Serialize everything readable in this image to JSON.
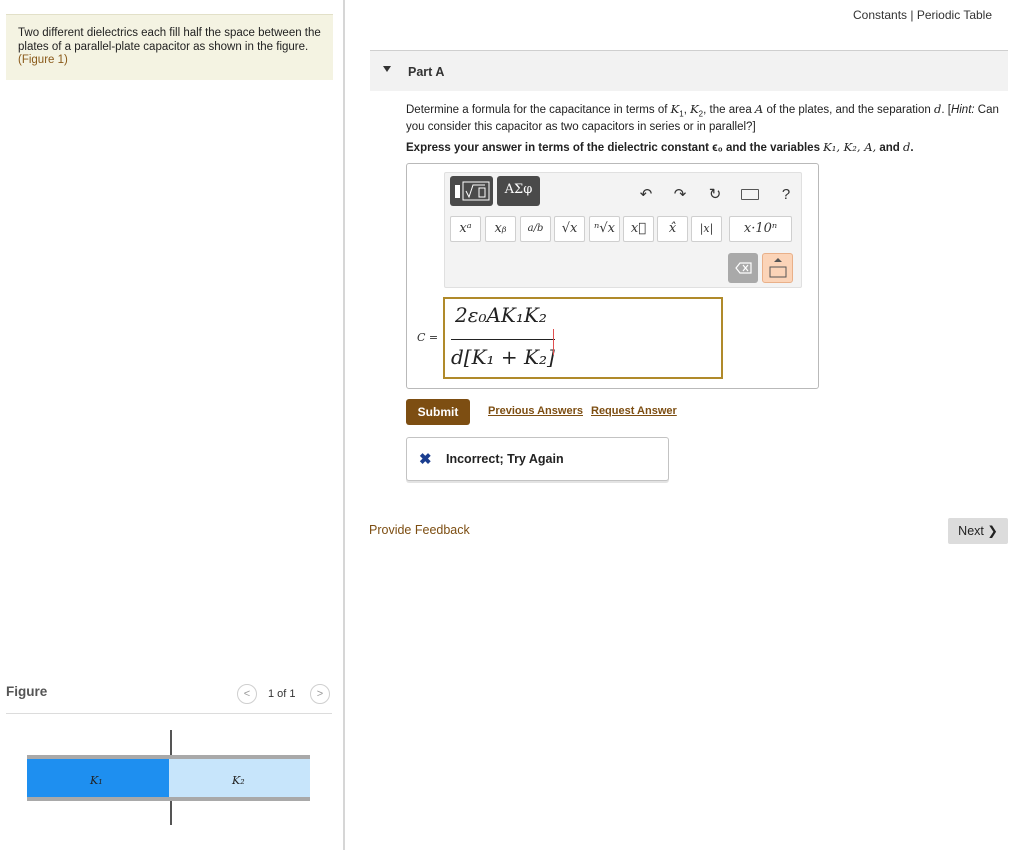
{
  "intro": {
    "text": "Two different dielectrics each fill half the space between the plates of a parallel-plate capacitor as shown in the figure.",
    "figure_link": "(Figure 1)"
  },
  "toplinks": {
    "constants": "Constants",
    "separator": "|",
    "periodic_table": "Periodic Table"
  },
  "part": {
    "label": "Part A"
  },
  "question": {
    "prefix": "Determine a formula for the capacitance in terms of",
    "k1": "K",
    "k1_sub": "1",
    "k2": "K",
    "k2_sub": "2",
    "mid": ", the area",
    "a": "A",
    "mid2": "of the plates, and the separation",
    "d": "d",
    "hint_open": ". [",
    "hint_label": "Hint:",
    "hint_text": "Can you consider this capacitor as two capacitors in series or in parallel?]"
  },
  "instruction": {
    "text": "Express your answer in terms of the dielectric constant ϵ₀ and the variables",
    "vars": "K₁, K₂, A,",
    "and": "and",
    "d": "d",
    "end": "."
  },
  "toolbar": {
    "greek_tab": "ΑΣφ",
    "buttons": [
      "xᵃ",
      "xᵦ",
      "a/b",
      "√x",
      "ⁿ√x",
      "x⃗",
      "x̂",
      "|x|",
      "x·10ⁿ"
    ],
    "undo": "↶",
    "redo": "↷",
    "reset": "↻",
    "help": "?"
  },
  "answer": {
    "label": "C =",
    "numerator": "2ε₀AK₁K₂",
    "denominator": "d[K₁ + K₂]"
  },
  "actions": {
    "submit": "Submit",
    "previous_answers": "Previous Answers",
    "request_answer": "Request Answer"
  },
  "feedback": {
    "mark": "✖",
    "message": "Incorrect; Try Again"
  },
  "footer": {
    "provide_feedback": "Provide Feedback",
    "next": "Next ❯"
  },
  "figure": {
    "title": "Figure",
    "count": "1 of 1",
    "prev": "<",
    "next": ">",
    "k1_label": "K₁",
    "k2_label": "K₂"
  },
  "colors": {
    "accent": "#7d4e12",
    "k1_fill": "#1e8ff0",
    "k2_fill": "#c7e5fb"
  }
}
